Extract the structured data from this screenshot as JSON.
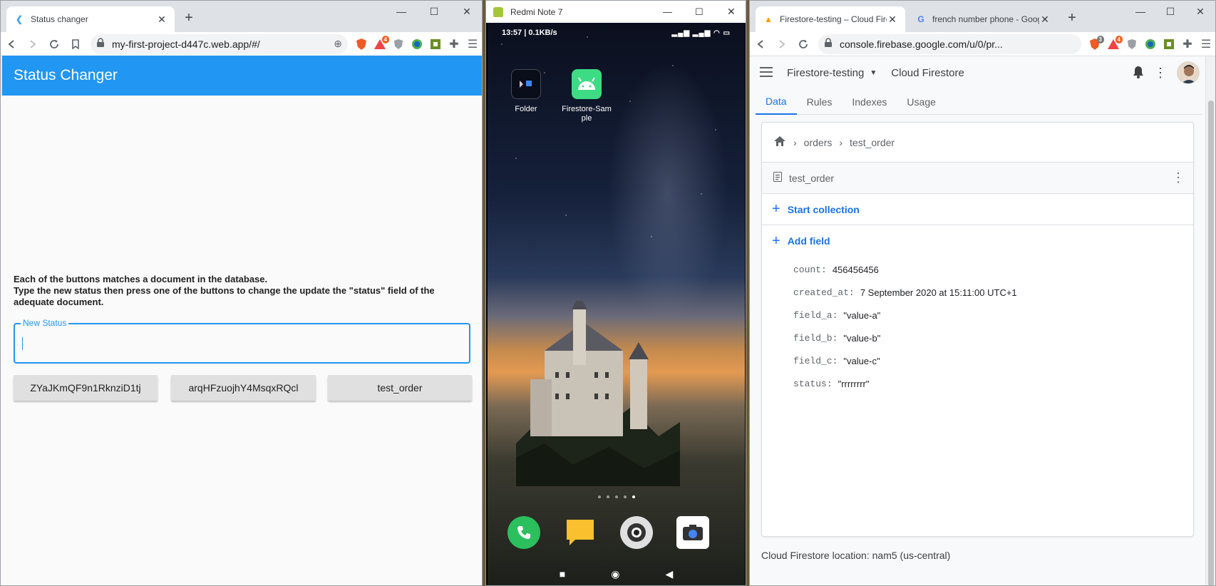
{
  "left": {
    "tab_title": "Status changer",
    "url": "my-first-project-d447c.web.app/#/",
    "brave_badge": "4",
    "app_title": "Status Changer",
    "instructions_line1": "Each of the buttons matches a document in the database.",
    "instructions_line2": "Type the new status then press one of the buttons to change the update the \"status\" field of the adequate document.",
    "field_label": "New Status",
    "field_value": "",
    "buttons": [
      {
        "label": "ZYaJKmQF9n1RknziD1tj"
      },
      {
        "label": "arqHFzuojhY4MsqxRQcl"
      },
      {
        "label": "test_order"
      }
    ]
  },
  "phone": {
    "window_title": "Redmi Note 7",
    "status_left": "13:57 | 0.1KB/s",
    "icons": [
      {
        "label": "Folder"
      },
      {
        "label": "Firestore-Sam\nple"
      }
    ],
    "dock": [
      "phone-icon",
      "notes-icon",
      "camera-lens-icon",
      "camera-icon"
    ]
  },
  "right": {
    "tabs": [
      {
        "title": "Firestore-testing – Cloud Fires"
      },
      {
        "title": "french number phone - Googl"
      }
    ],
    "url": "console.firebase.google.com/u/0/pr...",
    "badge_shield": "3",
    "badge_brave": "4",
    "project": "Firestore-testing",
    "product": "Cloud Firestore",
    "nav_tabs": [
      "Data",
      "Rules",
      "Indexes",
      "Usage"
    ],
    "breadcrumb": [
      "orders",
      "test_order"
    ],
    "document": "test_order",
    "start_collection": "Start collection",
    "add_field": "Add field",
    "fields": [
      {
        "key": "count:",
        "value": "456456456"
      },
      {
        "key": "created_at:",
        "value": "7 September 2020 at 15:11:00 UTC+1"
      },
      {
        "key": "field_a:",
        "value": "\"value-a\""
      },
      {
        "key": "field_b:",
        "value": "\"value-b\""
      },
      {
        "key": "field_c:",
        "value": "\"value-c\""
      },
      {
        "key": "status:",
        "value": "\"rrrrrrrr\""
      }
    ],
    "location": "Cloud Firestore location: nam5 (us-central)"
  },
  "colors": {
    "app_bar": "#2196f3",
    "firebase_blue": "#1a73e8",
    "android_green": "#3ddc84"
  }
}
